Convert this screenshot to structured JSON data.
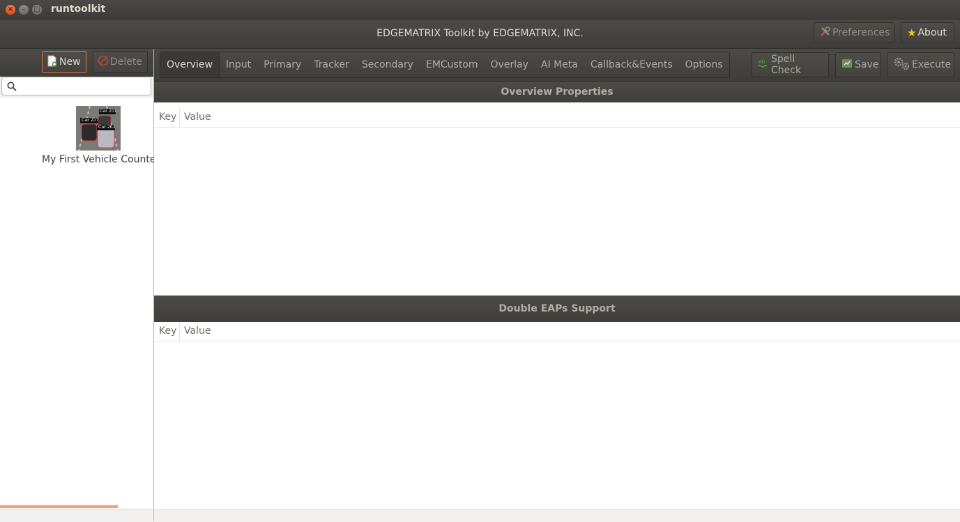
{
  "window": {
    "title": "runtoolkit"
  },
  "header": {
    "title": "EDGEMATRIX Toolkit by EDGEMATRIX, INC.",
    "preferences_label": "Preferences",
    "about_label": "About"
  },
  "sidebar": {
    "new_label": "New",
    "delete_label": "Delete",
    "search_placeholder": "",
    "projects": [
      {
        "label": "My First Vehicle Counter",
        "thumb_tags": [
          "Car 251",
          "Car 257",
          "Car 263"
        ]
      }
    ],
    "progress_fraction": 0.77
  },
  "tabs": [
    "Overview",
    "Input",
    "Primary",
    "Tracker",
    "Secondary",
    "EMCustom",
    "Overlay",
    "AI Meta",
    "Callback&Events",
    "Options"
  ],
  "active_tab": "Overview",
  "toolbar": {
    "spell_check_label": "Spell Check",
    "save_label": "Save",
    "execute_label": "Execute"
  },
  "sections": [
    {
      "title": "Overview Properties",
      "columns": [
        "Key",
        "Value"
      ],
      "rows": []
    },
    {
      "title": "Double EAPs Support",
      "columns": [
        "Key",
        "Value"
      ],
      "rows": []
    }
  ],
  "colors": {
    "accent": "#e9753c",
    "chrome": "#3c3b37",
    "progress": "#f0a07a"
  }
}
